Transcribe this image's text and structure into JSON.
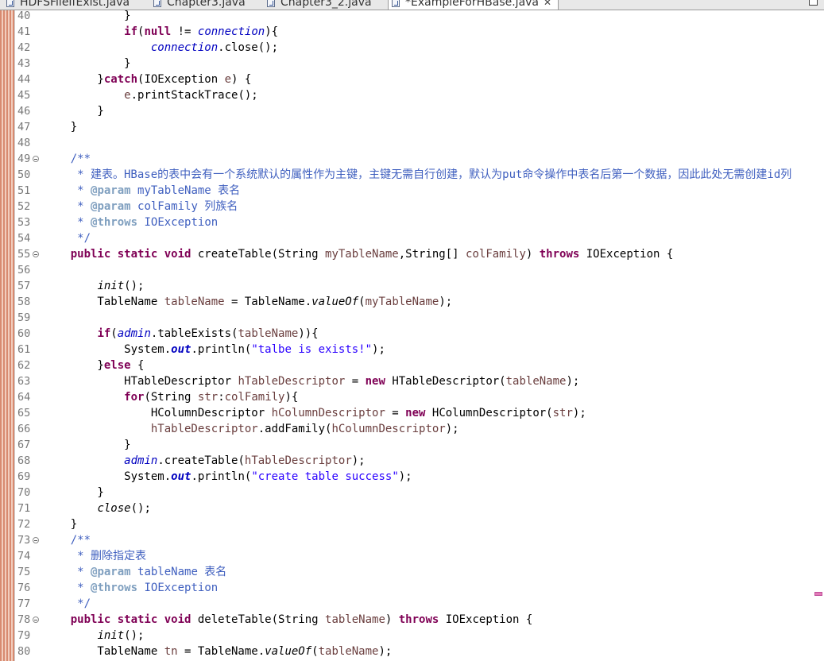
{
  "tabs": [
    {
      "label": "HDFSFileIfExist.java",
      "active": false
    },
    {
      "label": "Chapter3.java",
      "active": false
    },
    {
      "label": "Chapter3_2.java",
      "active": false
    },
    {
      "label": "*ExampleForHBase.java",
      "active": true,
      "close": "✕"
    }
  ],
  "lines": [
    {
      "n": "40",
      "fold": false,
      "code": [
        {
          "t": "            }"
        }
      ]
    },
    {
      "n": "41",
      "fold": false,
      "code": [
        {
          "t": "            "
        },
        {
          "t": "if",
          "c": "kw"
        },
        {
          "t": "("
        },
        {
          "t": "null",
          "c": "kw"
        },
        {
          "t": " != "
        },
        {
          "t": "connection",
          "c": "fld"
        },
        {
          "t": "){"
        }
      ]
    },
    {
      "n": "42",
      "fold": false,
      "code": [
        {
          "t": "                "
        },
        {
          "t": "connection",
          "c": "fld"
        },
        {
          "t": ".close();"
        }
      ]
    },
    {
      "n": "43",
      "fold": false,
      "code": [
        {
          "t": "            }"
        }
      ]
    },
    {
      "n": "44",
      "fold": false,
      "code": [
        {
          "t": "        }"
        },
        {
          "t": "catch",
          "c": "kw"
        },
        {
          "t": "(IOException "
        },
        {
          "t": "e",
          "c": "var"
        },
        {
          "t": ") {"
        }
      ]
    },
    {
      "n": "45",
      "fold": false,
      "code": [
        {
          "t": "            "
        },
        {
          "t": "e",
          "c": "var"
        },
        {
          "t": ".printStackTrace();"
        }
      ]
    },
    {
      "n": "46",
      "fold": false,
      "code": [
        {
          "t": "        }"
        }
      ]
    },
    {
      "n": "47",
      "fold": false,
      "code": [
        {
          "t": "    }"
        }
      ]
    },
    {
      "n": "48",
      "fold": false,
      "code": []
    },
    {
      "n": "49",
      "fold": true,
      "code": [
        {
          "t": "    "
        },
        {
          "t": "/**",
          "c": "cmt"
        }
      ]
    },
    {
      "n": "50",
      "fold": false,
      "code": [
        {
          "t": "     * 建表。HBase的表中会有一个系统默认的属性作为主键，主键无需自行创建，默认为put命令操作中表名后第一个数据，因此此处无需创建id列",
          "c": "cmt"
        }
      ]
    },
    {
      "n": "51",
      "fold": false,
      "code": [
        {
          "t": "     * ",
          "c": "cmt"
        },
        {
          "t": "@param",
          "c": "tag"
        },
        {
          "t": " myTableName 表名",
          "c": "cmt"
        }
      ]
    },
    {
      "n": "52",
      "fold": false,
      "code": [
        {
          "t": "     * ",
          "c": "cmt"
        },
        {
          "t": "@param",
          "c": "tag"
        },
        {
          "t": " colFamily 列族名",
          "c": "cmt"
        }
      ]
    },
    {
      "n": "53",
      "fold": false,
      "code": [
        {
          "t": "     * ",
          "c": "cmt"
        },
        {
          "t": "@throws",
          "c": "tag"
        },
        {
          "t": " IOException",
          "c": "cmt"
        }
      ]
    },
    {
      "n": "54",
      "fold": false,
      "code": [
        {
          "t": "     */",
          "c": "cmt"
        }
      ]
    },
    {
      "n": "55",
      "fold": true,
      "code": [
        {
          "t": "    "
        },
        {
          "t": "public static void",
          "c": "kw"
        },
        {
          "t": " createTable(String "
        },
        {
          "t": "myTableName",
          "c": "var"
        },
        {
          "t": ",String[] "
        },
        {
          "t": "colFamily",
          "c": "var"
        },
        {
          "t": ") "
        },
        {
          "t": "throws",
          "c": "kw"
        },
        {
          "t": " IOException {"
        }
      ]
    },
    {
      "n": "56",
      "fold": false,
      "code": []
    },
    {
      "n": "57",
      "fold": false,
      "code": [
        {
          "t": "        "
        },
        {
          "t": "init",
          "c": "it"
        },
        {
          "t": "();"
        }
      ]
    },
    {
      "n": "58",
      "fold": false,
      "code": [
        {
          "t": "        TableName "
        },
        {
          "t": "tableName",
          "c": "var"
        },
        {
          "t": " = TableName."
        },
        {
          "t": "valueOf",
          "c": "it"
        },
        {
          "t": "("
        },
        {
          "t": "myTableName",
          "c": "var"
        },
        {
          "t": ");"
        }
      ]
    },
    {
      "n": "59",
      "fold": false,
      "code": []
    },
    {
      "n": "60",
      "fold": false,
      "code": [
        {
          "t": "        "
        },
        {
          "t": "if",
          "c": "kw"
        },
        {
          "t": "("
        },
        {
          "t": "admin",
          "c": "fld"
        },
        {
          "t": ".tableExists("
        },
        {
          "t": "tableName",
          "c": "var"
        },
        {
          "t": ")){"
        }
      ]
    },
    {
      "n": "61",
      "fold": false,
      "code": [
        {
          "t": "            System."
        },
        {
          "t": "out",
          "c": "sfld"
        },
        {
          "t": ".println("
        },
        {
          "t": "\"talbe is exists!\"",
          "c": "str"
        },
        {
          "t": ");"
        }
      ]
    },
    {
      "n": "62",
      "fold": false,
      "code": [
        {
          "t": "        }"
        },
        {
          "t": "else",
          "c": "kw"
        },
        {
          "t": " {"
        }
      ]
    },
    {
      "n": "63",
      "fold": false,
      "code": [
        {
          "t": "            HTableDescriptor "
        },
        {
          "t": "hTableDescriptor",
          "c": "var"
        },
        {
          "t": " = "
        },
        {
          "t": "new",
          "c": "kw"
        },
        {
          "t": " HTableDescriptor("
        },
        {
          "t": "tableName",
          "c": "var"
        },
        {
          "t": ");"
        }
      ]
    },
    {
      "n": "64",
      "fold": false,
      "code": [
        {
          "t": "            "
        },
        {
          "t": "for",
          "c": "kw"
        },
        {
          "t": "(String "
        },
        {
          "t": "str",
          "c": "var"
        },
        {
          "t": ":"
        },
        {
          "t": "colFamily",
          "c": "var"
        },
        {
          "t": "){"
        }
      ]
    },
    {
      "n": "65",
      "fold": false,
      "code": [
        {
          "t": "                HColumnDescriptor "
        },
        {
          "t": "hColumnDescriptor",
          "c": "var"
        },
        {
          "t": " = "
        },
        {
          "t": "new",
          "c": "kw"
        },
        {
          "t": " HColumnDescriptor("
        },
        {
          "t": "str",
          "c": "var"
        },
        {
          "t": ");"
        }
      ]
    },
    {
      "n": "66",
      "fold": false,
      "code": [
        {
          "t": "                "
        },
        {
          "t": "hTableDescriptor",
          "c": "var"
        },
        {
          "t": ".addFamily("
        },
        {
          "t": "hColumnDescriptor",
          "c": "var"
        },
        {
          "t": ");"
        }
      ]
    },
    {
      "n": "67",
      "fold": false,
      "code": [
        {
          "t": "            }"
        }
      ]
    },
    {
      "n": "68",
      "fold": false,
      "code": [
        {
          "t": "            "
        },
        {
          "t": "admin",
          "c": "fld"
        },
        {
          "t": ".createTable("
        },
        {
          "t": "hTableDescriptor",
          "c": "var"
        },
        {
          "t": ");"
        }
      ]
    },
    {
      "n": "69",
      "fold": false,
      "code": [
        {
          "t": "            System."
        },
        {
          "t": "out",
          "c": "sfld"
        },
        {
          "t": ".println("
        },
        {
          "t": "\"create table success\"",
          "c": "str"
        },
        {
          "t": ");"
        }
      ]
    },
    {
      "n": "70",
      "fold": false,
      "code": [
        {
          "t": "        }"
        }
      ]
    },
    {
      "n": "71",
      "fold": false,
      "code": [
        {
          "t": "        "
        },
        {
          "t": "close",
          "c": "it"
        },
        {
          "t": "();"
        }
      ]
    },
    {
      "n": "72",
      "fold": false,
      "code": [
        {
          "t": "    }"
        }
      ]
    },
    {
      "n": "73",
      "fold": true,
      "code": [
        {
          "t": "    "
        },
        {
          "t": "/**",
          "c": "cmt"
        }
      ]
    },
    {
      "n": "74",
      "fold": false,
      "code": [
        {
          "t": "     * 删除指定表",
          "c": "cmt"
        }
      ]
    },
    {
      "n": "75",
      "fold": false,
      "code": [
        {
          "t": "     * ",
          "c": "cmt"
        },
        {
          "t": "@param",
          "c": "tag"
        },
        {
          "t": " tableName 表名",
          "c": "cmt"
        }
      ]
    },
    {
      "n": "76",
      "fold": false,
      "code": [
        {
          "t": "     * ",
          "c": "cmt"
        },
        {
          "t": "@throws",
          "c": "tag"
        },
        {
          "t": " IOException",
          "c": "cmt"
        }
      ]
    },
    {
      "n": "77",
      "fold": false,
      "code": [
        {
          "t": "     */",
          "c": "cmt"
        }
      ]
    },
    {
      "n": "78",
      "fold": true,
      "code": [
        {
          "t": "    "
        },
        {
          "t": "public static void",
          "c": "kw"
        },
        {
          "t": " deleteTable(String "
        },
        {
          "t": "tableName",
          "c": "var"
        },
        {
          "t": ") "
        },
        {
          "t": "throws",
          "c": "kw"
        },
        {
          "t": " IOException {"
        }
      ]
    },
    {
      "n": "79",
      "fold": false,
      "code": [
        {
          "t": "        "
        },
        {
          "t": "init",
          "c": "it"
        },
        {
          "t": "();"
        }
      ]
    },
    {
      "n": "80",
      "fold": false,
      "code": [
        {
          "t": "        TableName "
        },
        {
          "t": "tn",
          "c": "var"
        },
        {
          "t": " = TableName."
        },
        {
          "t": "valueOf",
          "c": "it"
        },
        {
          "t": "("
        },
        {
          "t": "tableName",
          "c": "var"
        },
        {
          "t": ");"
        }
      ]
    }
  ]
}
